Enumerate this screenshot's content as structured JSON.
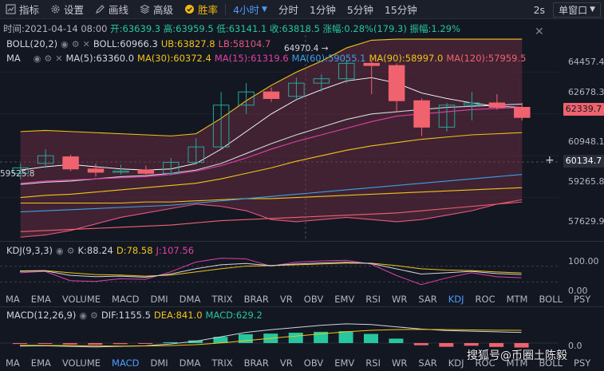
{
  "toolbar": {
    "indicators_label": "指标",
    "settings_label": "设置",
    "draw_label": "画线",
    "advanced_label": "高级",
    "winrate_label": "胜率",
    "interval_active": "4小时",
    "intervals": [
      "分时",
      "1分钟",
      "5分钟",
      "15分钟"
    ],
    "refresh": "2s",
    "window_mode": "单窗口"
  },
  "info_line": {
    "time": "时间:2021-04-14 08:00",
    "open": "开:63639.3",
    "high": "高:63959.5",
    "low": "低:63141.1",
    "close": "收:63818.5",
    "change": "涨幅:0.28%(179.3)",
    "amplitude": "振幅:1.29%"
  },
  "boll_legend": {
    "name": "BOLL(20,2)",
    "boll": "BOLL:60966.3",
    "ub": "UB:63827.8",
    "lb": "LB:58104.7"
  },
  "ma_legend": {
    "name": "MA",
    "ma5": "MA(5):63360.0",
    "ma30": "MA(30):60372.4",
    "ma15": "MA(15):61319.6",
    "ma60": "MA(60):59055.1",
    "ma90": "MA(90):58997.0",
    "ma120": "MA(120):57959.5"
  },
  "main_chart": {
    "high_annotation": "64970.4 →",
    "low_annotation": "59525.8",
    "price_axis": [
      "64457.4",
      "62678.3",
      "60948.1",
      "59265.8",
      "57629.9"
    ],
    "last_price": "62339.7",
    "cursor_price": "60134.7",
    "colors": {
      "up": "#26a69a",
      "down": "#f0626e",
      "bg": "#131722"
    }
  },
  "chart_data": {
    "type": "candlestick",
    "ylim": [
      56800,
      66300
    ],
    "candles": [
      {
        "o": 59800,
        "h": 60250,
        "l": 59525.8,
        "c": 60050,
        "dir": "up"
      },
      {
        "o": 60250,
        "h": 60900,
        "l": 60050,
        "c": 60600,
        "dir": "up"
      },
      {
        "o": 60550,
        "h": 60650,
        "l": 59900,
        "c": 60000,
        "dir": "down"
      },
      {
        "o": 60000,
        "h": 60250,
        "l": 59650,
        "c": 59850,
        "dir": "down"
      },
      {
        "o": 59900,
        "h": 60200,
        "l": 59750,
        "c": 59900,
        "dir": "up"
      },
      {
        "o": 59950,
        "h": 60150,
        "l": 59650,
        "c": 59800,
        "dir": "down"
      },
      {
        "o": 59800,
        "h": 60500,
        "l": 59700,
        "c": 60300,
        "dir": "up"
      },
      {
        "o": 60300,
        "h": 61400,
        "l": 60200,
        "c": 61000,
        "dir": "up"
      },
      {
        "o": 61000,
        "h": 63500,
        "l": 60900,
        "c": 62900,
        "dir": "up"
      },
      {
        "o": 62900,
        "h": 63900,
        "l": 62500,
        "c": 63500,
        "dir": "up"
      },
      {
        "o": 63500,
        "h": 63700,
        "l": 63050,
        "c": 63200,
        "dir": "down"
      },
      {
        "o": 63300,
        "h": 64150,
        "l": 63100,
        "c": 63900,
        "dir": "up"
      },
      {
        "o": 63900,
        "h": 64300,
        "l": 63500,
        "c": 64100,
        "dir": "up"
      },
      {
        "o": 64100,
        "h": 64970.4,
        "l": 63900,
        "c": 64800,
        "dir": "up"
      },
      {
        "o": 64800,
        "h": 64950,
        "l": 63400,
        "c": 64700,
        "dir": "down"
      },
      {
        "o": 64700,
        "h": 64800,
        "l": 62600,
        "c": 63100,
        "dir": "down"
      },
      {
        "o": 63100,
        "h": 63200,
        "l": 61500,
        "c": 61900,
        "dir": "down"
      },
      {
        "o": 61900,
        "h": 63000,
        "l": 61700,
        "c": 62900,
        "dir": "up"
      },
      {
        "o": 62900,
        "h": 63500,
        "l": 62200,
        "c": 63000,
        "dir": "up"
      },
      {
        "o": 63000,
        "h": 63400,
        "l": 62700,
        "c": 62800,
        "dir": "down"
      },
      {
        "o": 62800,
        "h": 63000,
        "l": 62200,
        "c": 62339.7,
        "dir": "down"
      }
    ],
    "boll_ub": [
      61700,
      61750,
      61700,
      61650,
      61600,
      61550,
      61500,
      61600,
      62300,
      63100,
      63800,
      64400,
      64900,
      65500,
      65850,
      65900,
      65900,
      65900,
      65900,
      65900,
      65900
    ],
    "boll_lb": [
      56900,
      57000,
      57200,
      57500,
      57800,
      58000,
      58200,
      58400,
      58300,
      58100,
      57700,
      57600,
      57700,
      57800,
      57700,
      57600,
      57700,
      57900,
      58100,
      58400,
      58600
    ],
    "boll_mid": [
      59300,
      59400,
      59450,
      59550,
      59650,
      59700,
      59800,
      59950,
      60250,
      60700,
      61150,
      61550,
      61900,
      62250,
      62500,
      62600,
      62700,
      62800,
      62850,
      62900,
      62950
    ],
    "ma5": [
      59950,
      60100,
      60200,
      60100,
      60000,
      59950,
      60000,
      60250,
      60900,
      61700,
      62500,
      63150,
      63600,
      64000,
      64150,
      63900,
      63450,
      63200,
      63000,
      62850,
      62800
    ],
    "ma15": [
      59350,
      59450,
      59500,
      59550,
      59600,
      59650,
      59750,
      59900,
      60150,
      60500,
      60900,
      61250,
      61550,
      61850,
      62150,
      62400,
      62500,
      62600,
      62700,
      62750,
      62800
    ],
    "ma30": [
      58700,
      58800,
      58850,
      58950,
      59050,
      59150,
      59250,
      59350,
      59550,
      59800,
      60050,
      60350,
      60600,
      60850,
      61050,
      61200,
      61350,
      61450,
      61550,
      61600,
      61650
    ],
    "ma60": [
      58050,
      58100,
      58150,
      58200,
      58250,
      58300,
      58350,
      58450,
      58550,
      58650,
      58750,
      58850,
      58950,
      59050,
      59150,
      59250,
      59350,
      59450,
      59550,
      59650,
      59750
    ],
    "ma90": [
      58450,
      58450,
      58450,
      58450,
      58450,
      58500,
      58500,
      58550,
      58600,
      58650,
      58650,
      58700,
      58750,
      58800,
      58850,
      58900,
      58950,
      59000,
      59050,
      59100,
      59150
    ],
    "ma120": [
      57150,
      57200,
      57250,
      57300,
      57350,
      57400,
      57450,
      57550,
      57650,
      57700,
      57750,
      57800,
      57850,
      57900,
      57950,
      58000,
      58100,
      58200,
      58300,
      58400,
      58500
    ]
  },
  "kdj": {
    "name": "KDJ(9,3,3)",
    "k": "K:88.24",
    "d": "D:78.58",
    "j": "J:107.56",
    "axis": [
      "100.00",
      "0.00"
    ],
    "k_series": [
      60,
      62,
      45,
      40,
      42,
      38,
      50,
      70,
      85,
      90,
      82,
      88,
      92,
      95,
      90,
      70,
      50,
      55,
      60,
      52,
      48
    ],
    "d_series": [
      62,
      63,
      55,
      48,
      46,
      42,
      46,
      58,
      70,
      80,
      82,
      85,
      88,
      91,
      91,
      82,
      70,
      65,
      63,
      58,
      54
    ],
    "j_series": [
      55,
      60,
      25,
      22,
      32,
      30,
      58,
      95,
      110,
      108,
      80,
      95,
      100,
      102,
      88,
      45,
      10,
      35,
      55,
      40,
      36
    ]
  },
  "kdj_tabs": [
    "MA",
    "EMA",
    "VOLUME",
    "MACD",
    "DMI",
    "DMA",
    "TRIX",
    "BRAR",
    "VR",
    "OBV",
    "EMV",
    "RSI",
    "WR",
    "SAR",
    "KDJ",
    "ROC",
    "MTM",
    "BOLL",
    "PSY"
  ],
  "macd": {
    "name": "MACD(12,26,9)",
    "dif": "DIF:1155.5",
    "dea": "DEA:841.0",
    "macd": "MACD:629.2",
    "axis": "0.0",
    "hist": [
      -60,
      -40,
      -90,
      -110,
      -70,
      -40,
      60,
      180,
      420,
      600,
      640,
      700,
      760,
      800,
      620,
      300,
      -150,
      -250,
      -180,
      -260,
      -300
    ],
    "dif_series": [
      -200,
      -180,
      -220,
      -260,
      -220,
      -180,
      -60,
      120,
      420,
      720,
      900,
      1050,
      1200,
      1300,
      1250,
      1100,
      950,
      850,
      800,
      760,
      720
    ],
    "dea_series": [
      -150,
      -160,
      -170,
      -190,
      -200,
      -195,
      -170,
      -110,
      10,
      160,
      320,
      470,
      620,
      760,
      860,
      910,
      920,
      910,
      890,
      870,
      860
    ]
  },
  "macd_tabs": [
    "MA",
    "EMA",
    "VOLUME",
    "MACD",
    "DMI",
    "DMA",
    "TRIX",
    "BRAR",
    "VR",
    "OBV",
    "EMV",
    "RSI",
    "WR",
    "SAR",
    "KDJ",
    "ROC",
    "MTM",
    "BOLL",
    "PSY"
  ],
  "watermark": "搜狐号@币圈土陈毅"
}
